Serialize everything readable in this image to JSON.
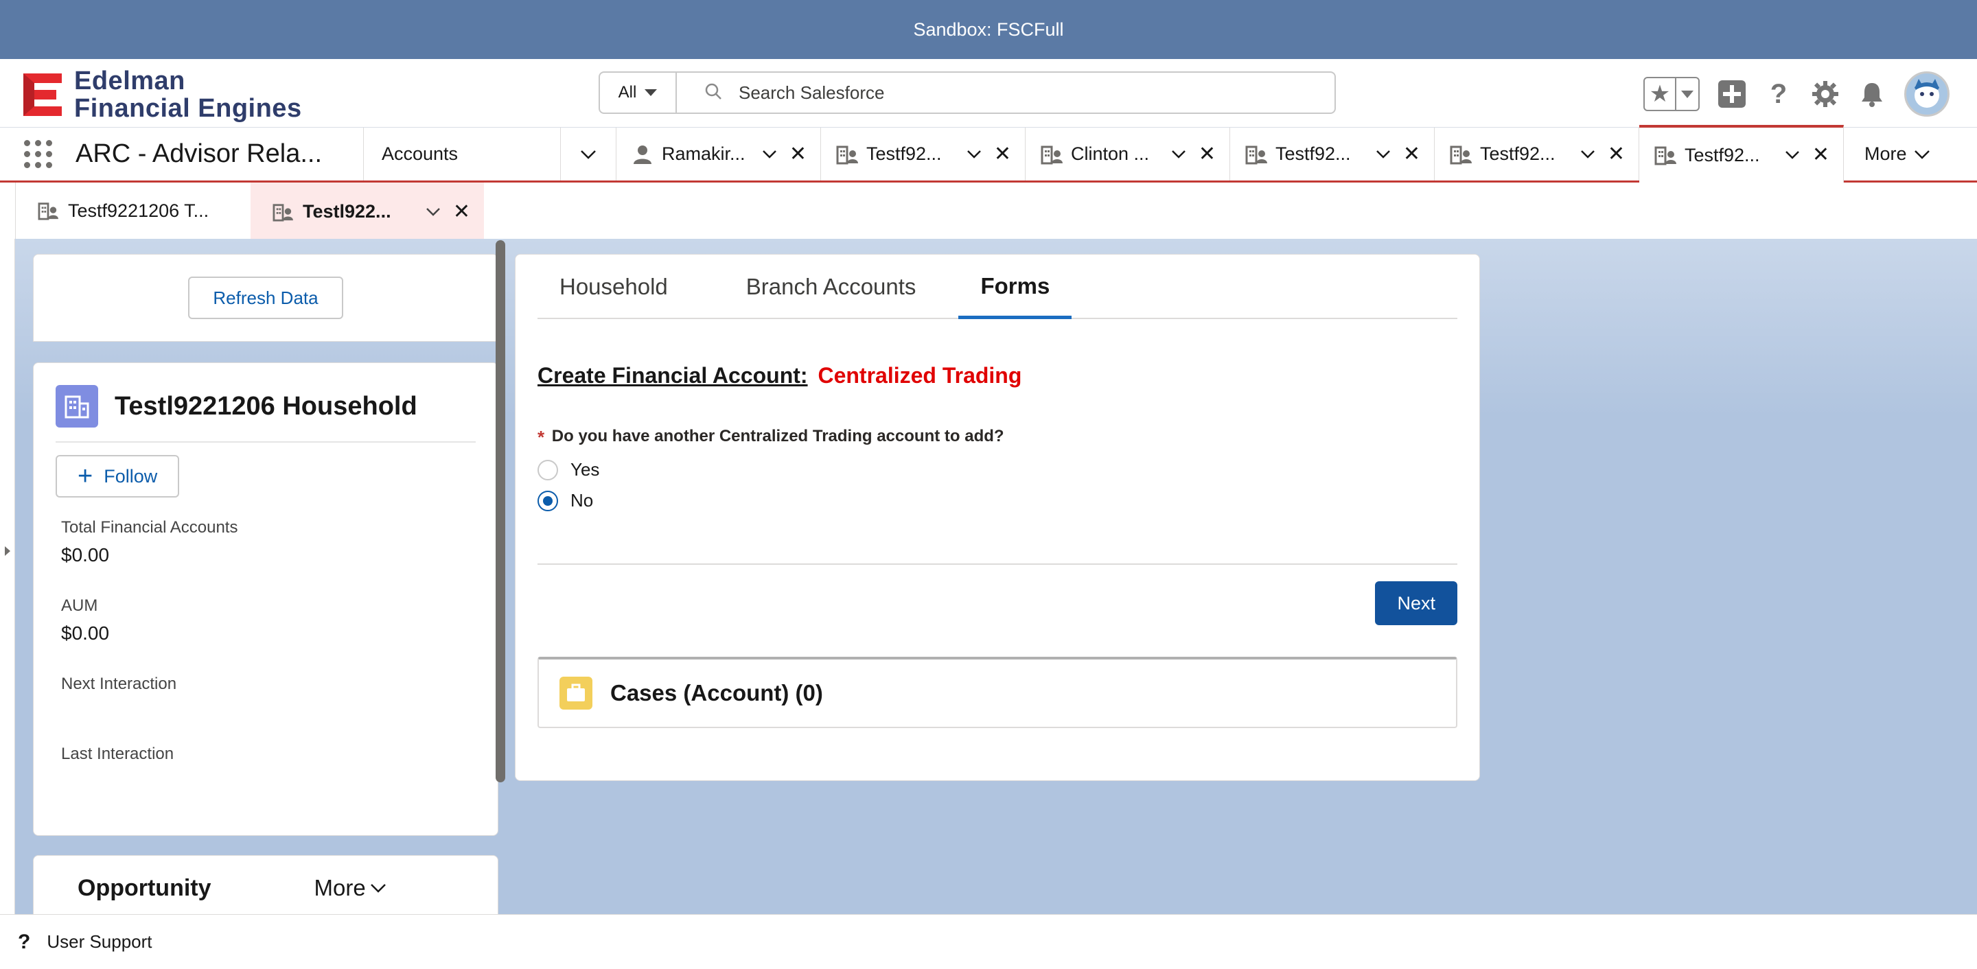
{
  "banner": {
    "text": "Sandbox: FSCFull"
  },
  "brand": {
    "line1": "Edelman",
    "line2": "Financial Engines",
    "color": "#e4292e"
  },
  "search": {
    "scope": "All",
    "placeholder": "Search Salesforce"
  },
  "nav": {
    "app_name": "ARC - Advisor Rela...",
    "accounts_label": "Accounts",
    "tabs": [
      {
        "label": "Ramakir...",
        "icon": "person-icon"
      },
      {
        "label": "Testf92...",
        "icon": "household-icon"
      },
      {
        "label": "Clinton ...",
        "icon": "household-icon"
      },
      {
        "label": "Testf92...",
        "icon": "household-icon"
      },
      {
        "label": "Testf92...",
        "icon": "household-icon"
      },
      {
        "label": "Testf92...",
        "icon": "household-icon",
        "active": true
      }
    ],
    "more_label": "More"
  },
  "subtabs": [
    {
      "label": "Testf9221206 T...",
      "icon": "household-icon"
    },
    {
      "label": "Testl922...",
      "icon": "household-icon",
      "active": true
    }
  ],
  "refresh": {
    "label": "Refresh Data"
  },
  "household": {
    "title": "Testl9221206 Household",
    "follow_label": "Follow",
    "fields": [
      {
        "label": "Total Financial Accounts",
        "value": "$0.00"
      },
      {
        "label": "AUM",
        "value": "$0.00"
      },
      {
        "label": "Next Interaction",
        "value": ""
      },
      {
        "label": "Last Interaction",
        "value": ""
      }
    ]
  },
  "opportunity": {
    "title": "Opportunity",
    "more_label": "More"
  },
  "forms": {
    "tabs": [
      "Household",
      "Branch Accounts",
      "Forms"
    ],
    "active_tab": "Forms",
    "title_prefix": "Create Financial Account:",
    "title_highlight": "Centralized Trading",
    "required_mark": "*",
    "question": "Do you have another Centralized Trading account to add?",
    "options": [
      {
        "label": "Yes",
        "checked": false
      },
      {
        "label": "No",
        "checked": true
      }
    ],
    "next_label": "Next"
  },
  "cases": {
    "title": "Cases (Account) (0)"
  },
  "utility": {
    "label": "User Support"
  },
  "colors": {
    "accent": "#0b5cab",
    "brand_button": "#12529c",
    "active_tab_border": "#c23934",
    "highlight": "#e00000"
  }
}
